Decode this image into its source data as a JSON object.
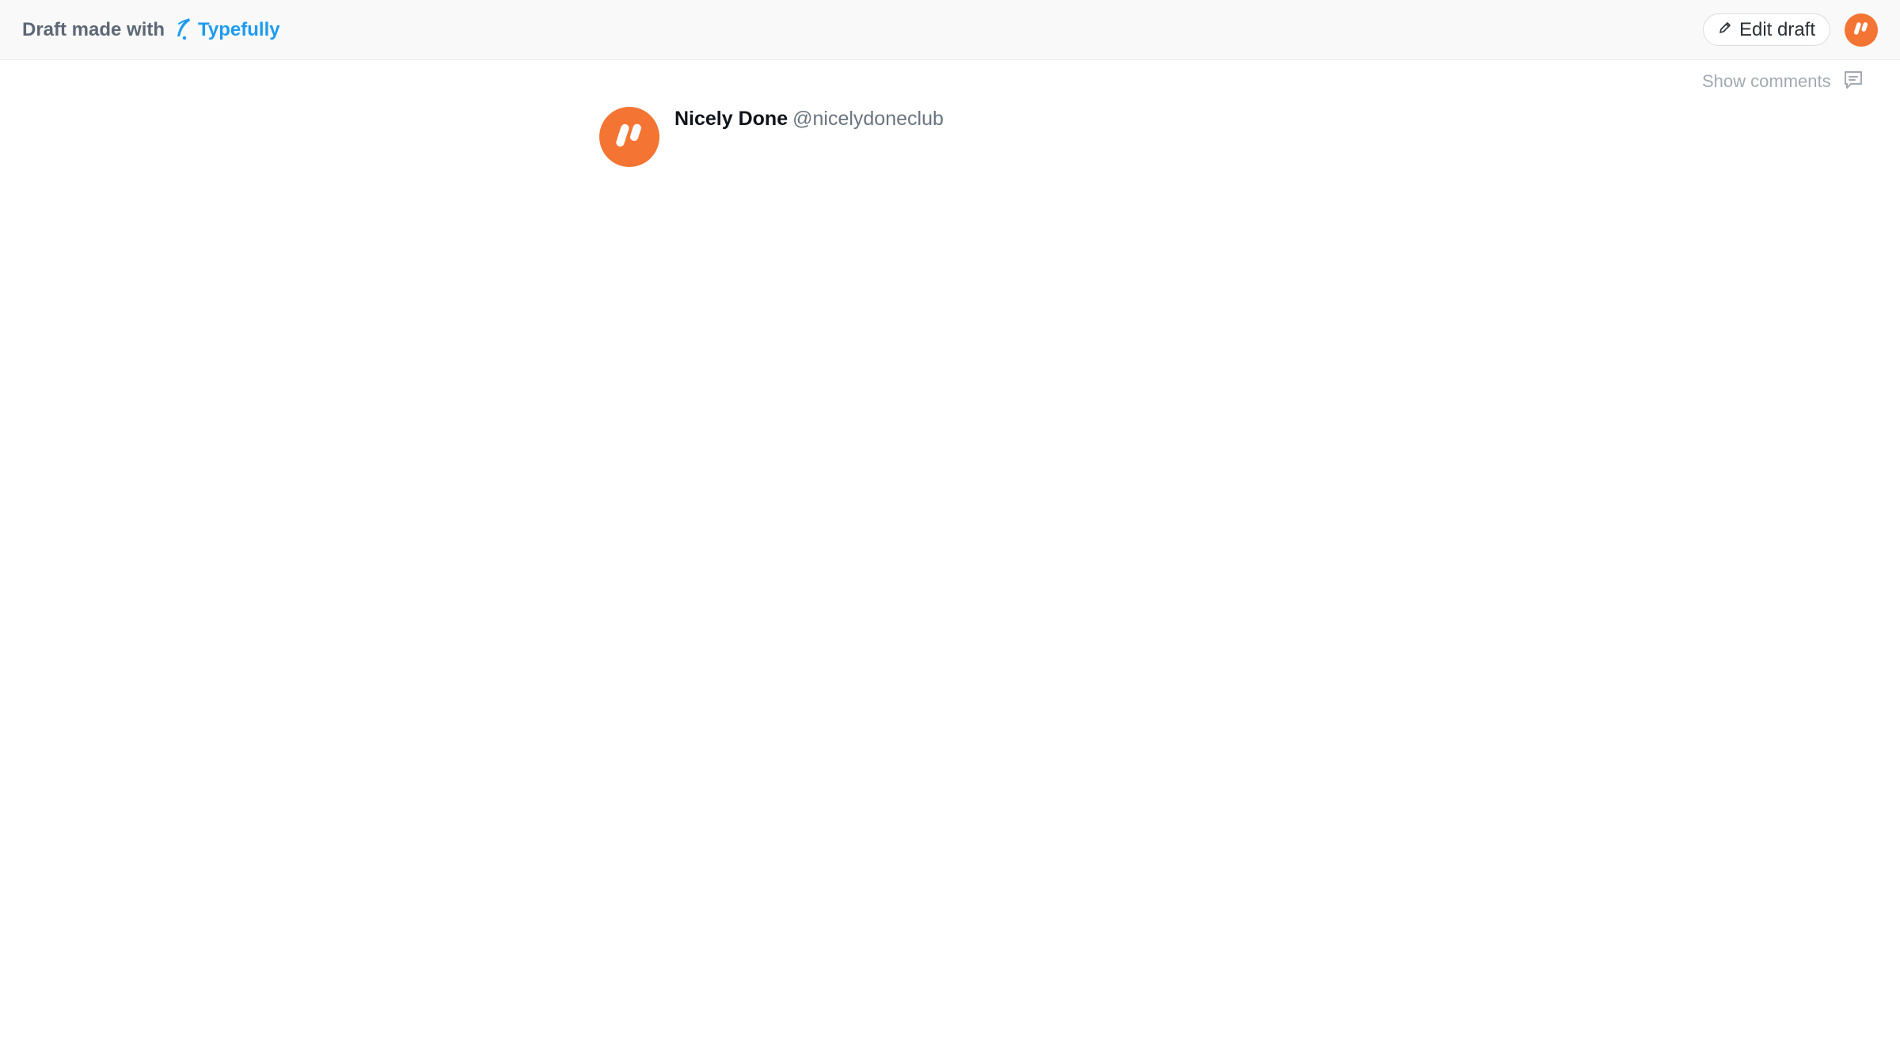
{
  "header": {
    "prefix": "Draft made with",
    "brand_name": "Typefully",
    "edit_label": "Edit draft"
  },
  "comments": {
    "toggle_label": "Show comments"
  },
  "tweet": {
    "author_name": "Nicely Done",
    "author_handle": "@nicelydoneclub"
  },
  "icons": {
    "brand": "feather-icon",
    "edit": "pencil-icon",
    "comments": "comment-icon",
    "avatar": "nicely-done-logo-icon"
  },
  "colors": {
    "brand_blue": "#1d9bf0",
    "avatar_orange": "#f47433",
    "muted_text": "#6a7480",
    "header_bg": "#f9f9f9"
  }
}
